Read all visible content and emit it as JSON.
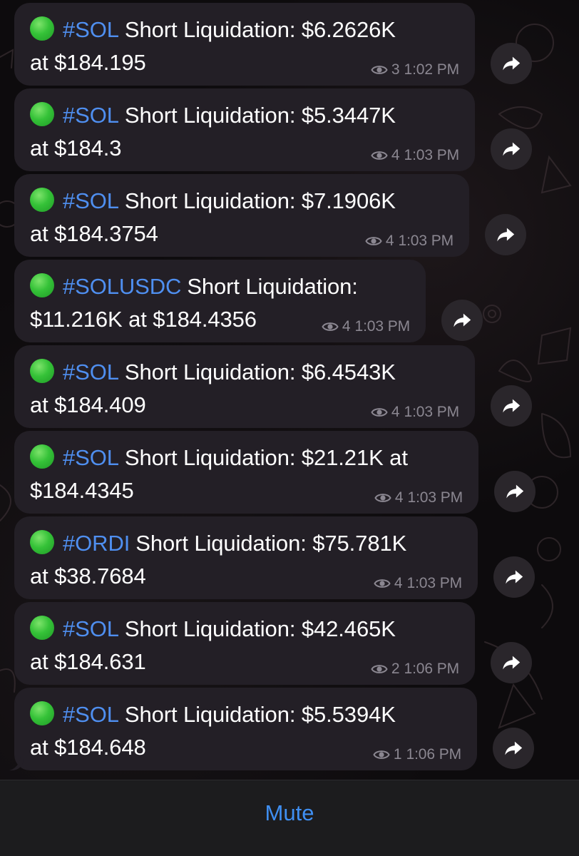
{
  "colors": {
    "bubble": "#231f26",
    "tag": "#4f8ff0",
    "meta": "#8b8791",
    "accent": "#3f8ff2",
    "status_emoji": "green-circle"
  },
  "messages": [
    {
      "tag": "#SOL",
      "line1": "Short Liquidation: $6.2626K",
      "line2": "at $184.195",
      "views": "3",
      "time": "1:02 PM"
    },
    {
      "tag": "#SOL",
      "line1": "Short Liquidation: $5.3447K",
      "line2": "at $184.3",
      "views": "4",
      "time": "1:03 PM"
    },
    {
      "tag": "#SOL",
      "line1": "Short Liquidation: $7.1906K",
      "line2": "at $184.3754",
      "views": "4",
      "time": "1:03 PM"
    },
    {
      "tag": "#SOLUSDC",
      "line1": "Short Liquidation:",
      "line2": "$11.216K at $184.4356",
      "views": "4",
      "time": "1:03 PM"
    },
    {
      "tag": "#SOL",
      "line1": "Short Liquidation: $6.4543K",
      "line2": "at $184.409",
      "views": "4",
      "time": "1:03 PM"
    },
    {
      "tag": "#SOL",
      "line1": "Short Liquidation: $21.21K at",
      "line2": "$184.4345",
      "views": "4",
      "time": "1:03 PM"
    },
    {
      "tag": "#ORDI",
      "line1": "Short Liquidation: $75.781K",
      "line2": "at $38.7684",
      "views": "4",
      "time": "1:03 PM"
    },
    {
      "tag": "#SOL",
      "line1": "Short Liquidation: $42.465K",
      "line2": "at $184.631",
      "views": "2",
      "time": "1:06 PM"
    },
    {
      "tag": "#SOL",
      "line1": "Short Liquidation: $5.5394K",
      "line2": "at $184.648",
      "views": "1",
      "time": "1:06 PM"
    }
  ],
  "bottom_bar": {
    "mute_label": "Mute"
  }
}
